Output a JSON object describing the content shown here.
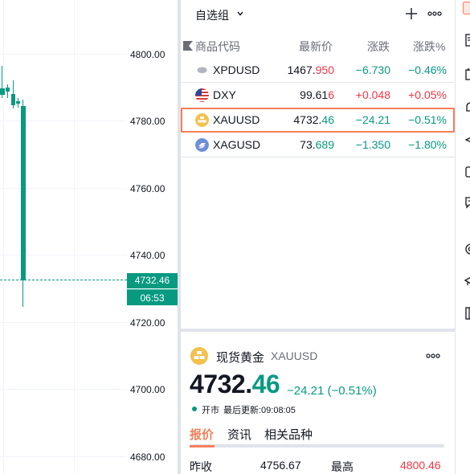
{
  "chart": {
    "price_ticks": [
      "4800.00",
      "4780.00",
      "4760.00",
      "4740.00",
      "4720.00",
      "4700.00",
      "4680.00"
    ],
    "current_price": "4732.46",
    "countdown": "06:53",
    "colors": {
      "up": "#089981",
      "grid": "#f0f3fa"
    }
  },
  "watchlist": {
    "title": "自选组",
    "columns": {
      "symbol": "商品代码",
      "last": "最新价",
      "change": "涨跌",
      "change_pct": "涨跌%"
    },
    "rows": [
      {
        "symbol": "XPDUSD",
        "last_main": "1467.",
        "last_tail": "950",
        "tail_dir": "up",
        "change": "−6.730",
        "change_pct": "−0.46%",
        "dir": "down",
        "icon": "palladium-icon"
      },
      {
        "symbol": "DXY",
        "last_main": "99.61",
        "last_tail": "6",
        "tail_dir": "up",
        "change": "+0.048",
        "change_pct": "+0.05%",
        "dir": "up",
        "icon": "us-flag-icon"
      },
      {
        "symbol": "XAUUSD",
        "last_main": "4732.",
        "last_tail": "46",
        "tail_dir": "down",
        "change": "−24.21",
        "change_pct": "−0.51%",
        "dir": "down",
        "icon": "gold-icon",
        "selected": true
      },
      {
        "symbol": "XAGUSD",
        "last_main": "73.",
        "last_tail": "689",
        "tail_dir": "down",
        "change": "−1.350",
        "change_pct": "−1.80%",
        "dir": "down",
        "icon": "silver-icon"
      }
    ]
  },
  "details": {
    "name": "现货黄金",
    "symbol": "XAUUSD",
    "price_main": "4732.",
    "price_dec": "46",
    "change_text": "−24.21 (−0.51%)",
    "status": "开市",
    "updated": "最后更新:09:08:05",
    "tabs": [
      "报价",
      "资讯",
      "相关品种"
    ],
    "stats": [
      {
        "label": "昨收",
        "value": "4756.67"
      },
      {
        "label": "最高",
        "value": "4800.46"
      }
    ],
    "colors": {
      "accent": "#f57f5a",
      "down": "#089981",
      "up": "#f23645"
    }
  }
}
